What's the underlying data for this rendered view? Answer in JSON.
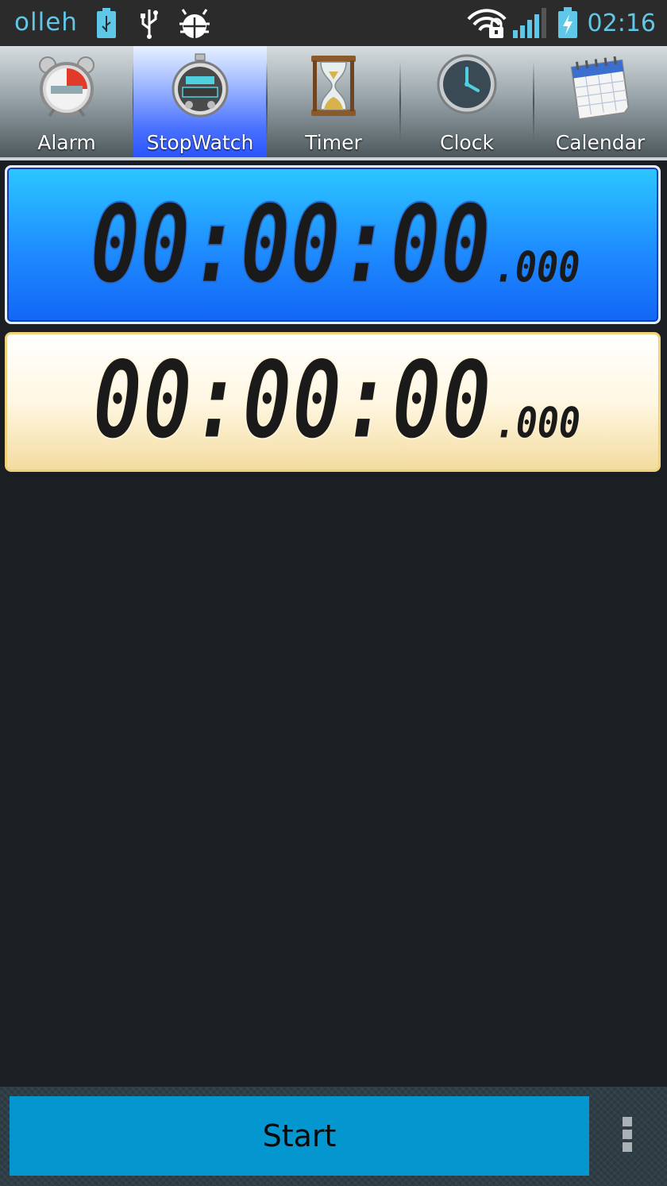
{
  "status_bar": {
    "carrier": "olleh",
    "time": "02:16",
    "icons": [
      "usb-storage-icon",
      "usb-icon",
      "android-debug-icon",
      "wifi-locked-icon",
      "signal-icon",
      "battery-charging-icon"
    ]
  },
  "tabs": [
    {
      "label": "Alarm",
      "icon": "alarm-clock-icon"
    },
    {
      "label": "StopWatch",
      "icon": "stopwatch-icon",
      "active": true
    },
    {
      "label": "Timer",
      "icon": "hourglass-icon"
    },
    {
      "label": "Clock",
      "icon": "clock-icon"
    },
    {
      "label": "Calendar",
      "icon": "calendar-icon"
    }
  ],
  "main_display": {
    "hms": "00:00:00",
    "ms": ".000"
  },
  "lap_display": {
    "hms": "00:00:00",
    "ms": ".000"
  },
  "bottom_bar": {
    "start_label": "Start",
    "menu_icon": "overflow-menu-icon"
  },
  "colors": {
    "accent": "#5fc7e8",
    "active_tab": "#2a55ff",
    "main_display": "#1e8bff",
    "lap_display": "#f3dca0",
    "start_button": "#0396cf"
  }
}
